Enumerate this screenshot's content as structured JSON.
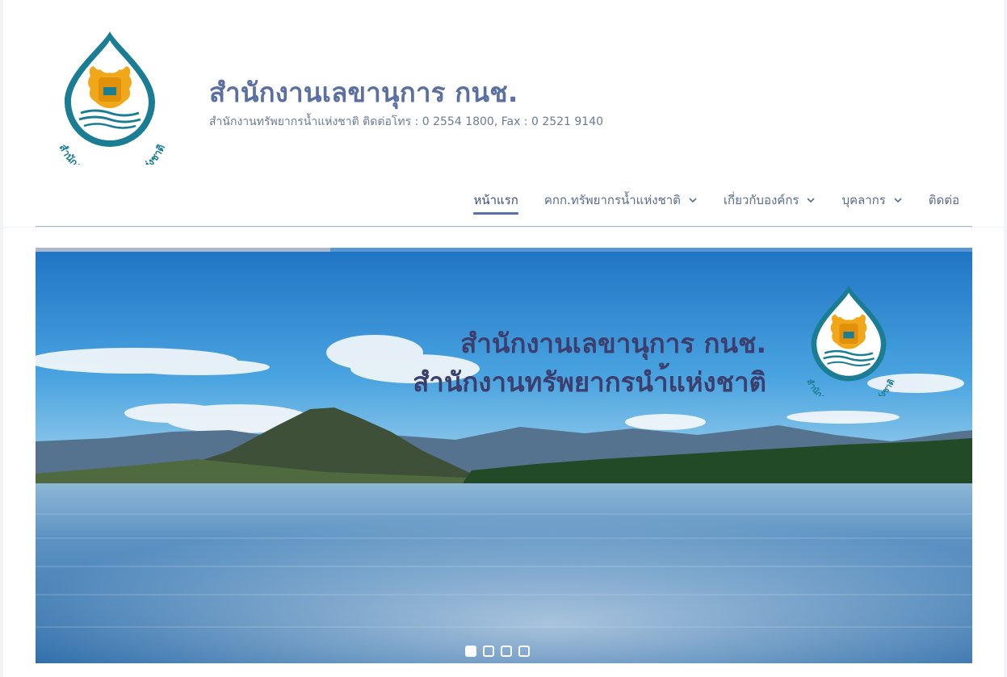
{
  "header": {
    "title": "สำนักงานเลขานุการ กนช.",
    "description": "สำนักงานทรัพยากรน้ำแห่งชาติ ติดต่อโทร : 0 2554 1800, Fax : 0 2521 9140",
    "logo_text": "สำนักงานทรัพยากรน้ำแห่งชาติ"
  },
  "nav": {
    "items": [
      {
        "label": "หน้าแรก",
        "active": true,
        "dropdown": false
      },
      {
        "label": "คกก.ทรัพยากรน้ำแห่งชาติ",
        "active": false,
        "dropdown": true
      },
      {
        "label": "เกี่ยวกับองค์กร",
        "active": false,
        "dropdown": true
      },
      {
        "label": "บุคลากร",
        "active": false,
        "dropdown": true
      },
      {
        "label": "ติดต่อ",
        "active": false,
        "dropdown": false
      }
    ]
  },
  "slider": {
    "line1": "สำนักงานเลขานุการ กนช.",
    "line2": "สำนักงานทรัพยากรนำ้แห่งชาติ",
    "logo_text": "สำนักงานทรัพยากรน้ำแห่งชาติ",
    "progress": 0.315,
    "slide_count": 4,
    "current_slide": 1
  },
  "colors": {
    "title": "#5a6fa3",
    "nav_text": "#5b6b8c",
    "nav_active_underline": "#5b6fa8",
    "banner_text": "#3c3f6e",
    "logo_teal": "#1b7d93",
    "logo_gold": "#f2a71b"
  }
}
